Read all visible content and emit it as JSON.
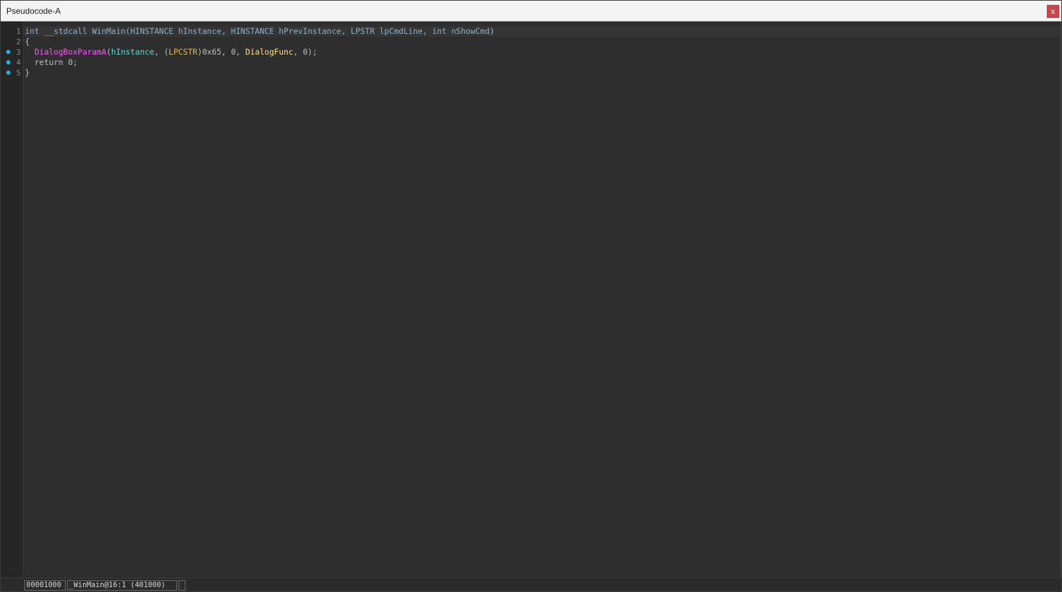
{
  "window": {
    "title": "Pseudocode-A",
    "close_label": "x"
  },
  "code": {
    "lines": [
      {
        "number": "1",
        "breakpoint": false
      },
      {
        "number": "2",
        "breakpoint": false
      },
      {
        "number": "3",
        "breakpoint": true
      },
      {
        "number": "4",
        "breakpoint": true
      },
      {
        "number": "5",
        "breakpoint": true
      }
    ],
    "line1": {
      "ret_type": "int",
      "callconv": "__stdcall",
      "func_name": "WinMain",
      "open_paren": "(",
      "p1_type": "HINSTANCE",
      "p1_name": "hInstance",
      "sep1": ", ",
      "p2_type": "HINSTANCE",
      "p2_name": "hPrevInstance",
      "sep2": ", ",
      "p3_type": "LPSTR",
      "p3_name": "lpCmdLine",
      "sep3": ", ",
      "p4_type": "int",
      "p4_name": "nShowCmd",
      "close_paren": ")"
    },
    "line2": {
      "text": "{"
    },
    "line3": {
      "indent": "  ",
      "call_name": "DialogBoxParamA",
      "open_paren": "(",
      "arg1": "hInstance",
      "sep1": ", ",
      "cast_open": "(",
      "cast_type": "LPCSTR",
      "cast_close": ")",
      "arg2": "0x65",
      "sep2": ", ",
      "arg3": "0",
      "sep3": ", ",
      "arg4": "DialogFunc",
      "sep4": ", ",
      "arg5": "0",
      "close": ");"
    },
    "line4": {
      "indent": "  ",
      "keyword": "return",
      "value": " 0;"
    },
    "line5": {
      "text": "}"
    }
  },
  "status": {
    "address": "00001000",
    "location": "_WinMain@16:1 (401000)",
    "extra": ""
  },
  "colors": {
    "background": "#2e2e2e",
    "gutter": "#262626",
    "breakpoint": "#1fb6e8",
    "import_function": "#ff55ff",
    "user_function": "#ffe28a",
    "argument": "#50e0d8",
    "type_cast": "#e6b84a",
    "close_button": "#c8454a"
  }
}
